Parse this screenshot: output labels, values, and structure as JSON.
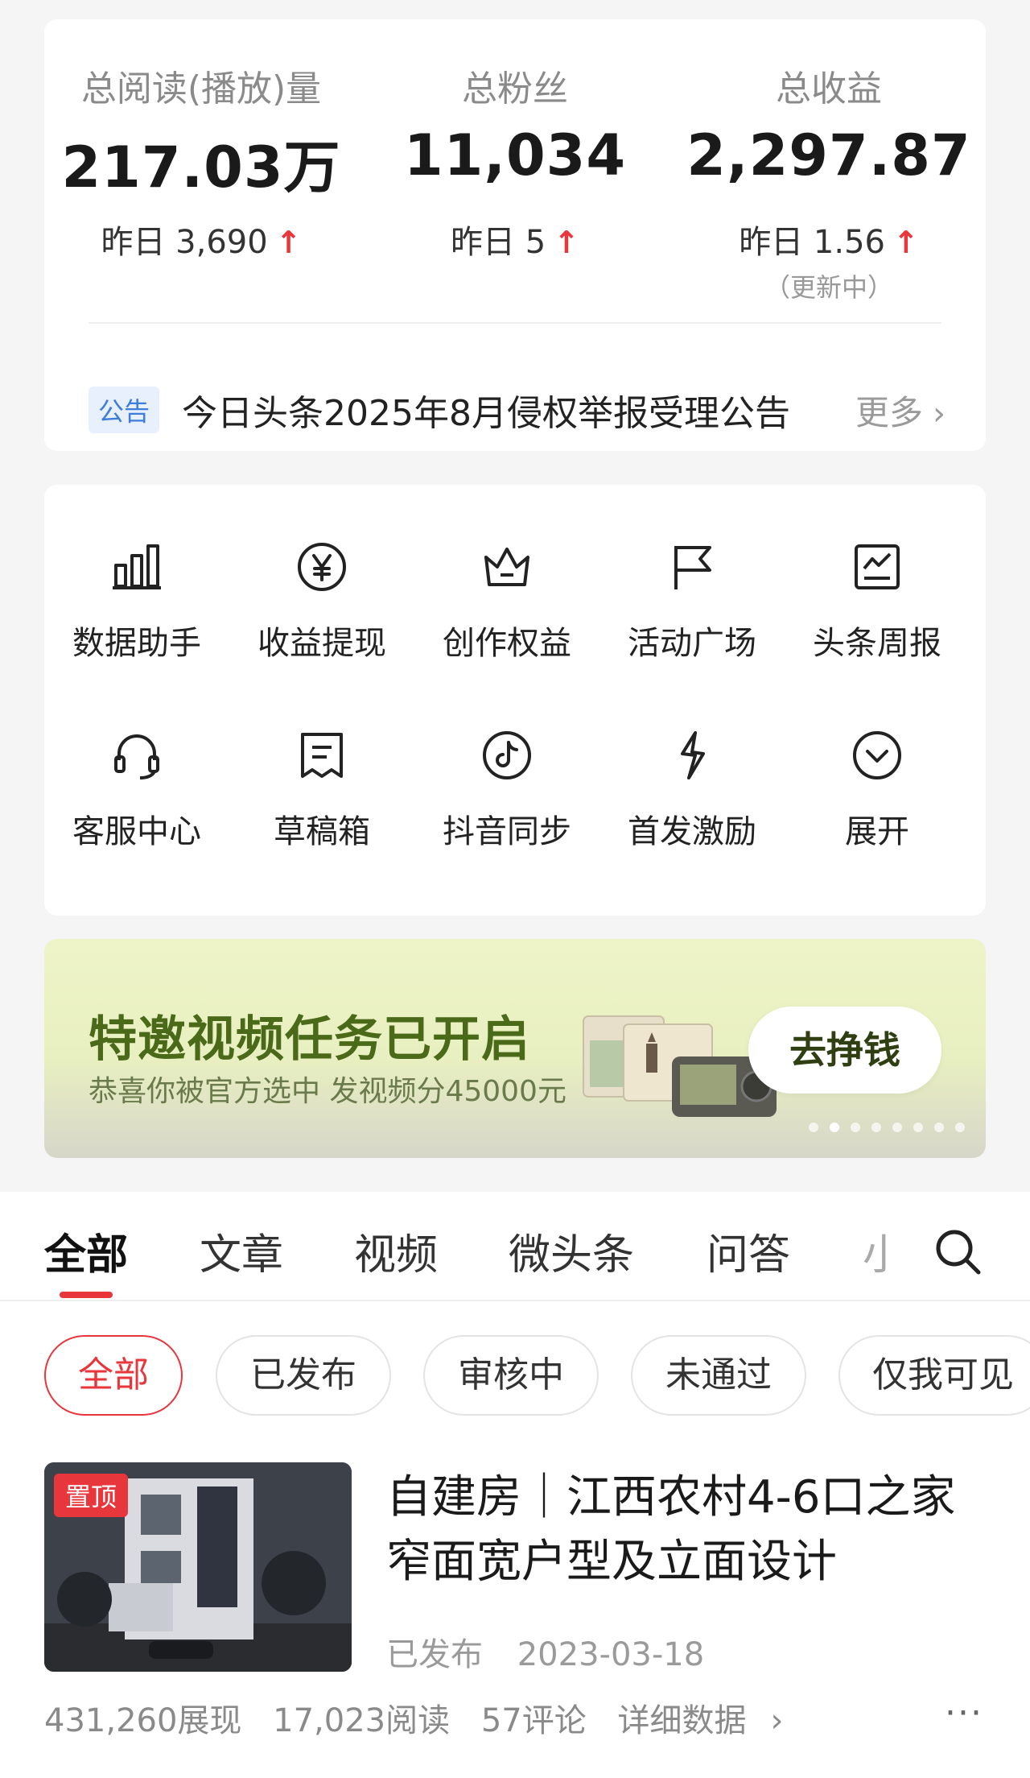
{
  "stats": {
    "reads": {
      "label": "总阅读(播放)量",
      "value": "217.03万",
      "delta": "昨日 3,690",
      "arrow": "↑"
    },
    "fans": {
      "label": "总粉丝",
      "value": "11,034",
      "delta": "昨日 5",
      "arrow": "↑"
    },
    "earnings": {
      "label": "总收益",
      "value": "2,297.87",
      "delta": "昨日 1.56",
      "arrow": "↑",
      "note": "（更新中）"
    }
  },
  "notice": {
    "tag": "公告",
    "text": "今日头条2025年8月侵权举报受理公告",
    "more": "更多"
  },
  "tools": [
    {
      "label": "数据助手",
      "icon": "bar-chart-icon"
    },
    {
      "label": "收益提现",
      "icon": "yuan-coin-icon"
    },
    {
      "label": "创作权益",
      "icon": "crown-icon"
    },
    {
      "label": "活动广场",
      "icon": "flag-icon"
    },
    {
      "label": "头条周报",
      "icon": "report-chart-icon"
    },
    {
      "label": "客服中心",
      "icon": "headset-icon"
    },
    {
      "label": "草稿箱",
      "icon": "draft-box-icon"
    },
    {
      "label": "抖音同步",
      "icon": "douyin-icon"
    },
    {
      "label": "首发激励",
      "icon": "lightning-icon"
    },
    {
      "label": "展开",
      "icon": "expand-chevron-icon"
    }
  ],
  "banner": {
    "title": "特邀视频任务已开启",
    "subtitle": "恭喜你被官方选中 发视频分45000元",
    "button": "去挣钱",
    "slide_count": 8,
    "active_slide": 1
  },
  "tabs": {
    "items": [
      "全部",
      "文章",
      "视频",
      "微头条",
      "问答",
      "小"
    ],
    "active": 0
  },
  "filters": {
    "items": [
      "全部",
      "已发布",
      "审核中",
      "未通过",
      "仅我可见"
    ],
    "active": 0
  },
  "article": {
    "pin": "置顶",
    "title": "自建房｜江西农村4-6口之家窄面宽户型及立面设计",
    "status": "已发布",
    "date": "2023-03-18",
    "impressions": "431,260展现",
    "reads": "17,023阅读",
    "comments": "57评论",
    "details": "详细数据",
    "more": "···"
  },
  "colors": {
    "accent_red": "#e8363d",
    "notice_blue": "#3d7ddb",
    "banner_green": "#4a6a1a"
  }
}
